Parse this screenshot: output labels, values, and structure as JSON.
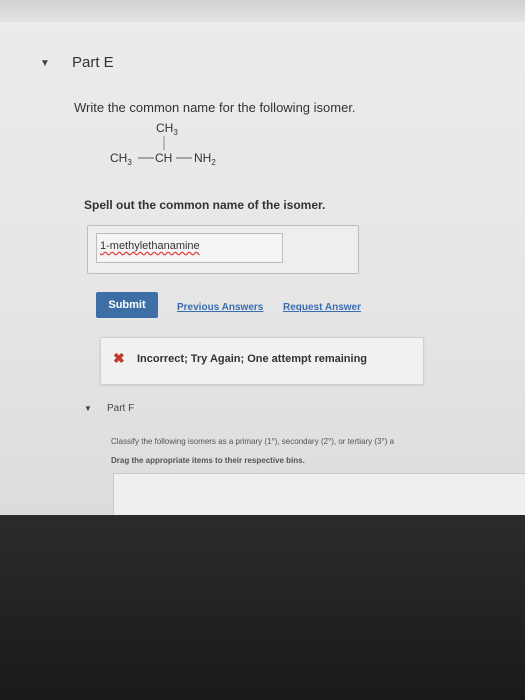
{
  "part_e": {
    "title": "Part E",
    "question": "Write the common name for the following isomer.",
    "molecule": {
      "top": "CH3",
      "left": "CH3",
      "center": "CH",
      "right": "NH2"
    },
    "instruction": "Spell out the common name of the isomer.",
    "answer_value": "1-methylethanamine",
    "submit_label": "Submit",
    "previous_answers_label": "Previous Answers",
    "request_answer_label": "Request Answer",
    "feedback": "Incorrect; Try Again; One attempt remaining"
  },
  "part_f": {
    "title": "Part F",
    "classify_text": "Classify the following isomers as a primary (1°), secondary (2°), or tertiary (3°) a",
    "drag_text": "Drag the appropriate items to their respective bins."
  },
  "icons": {
    "collapse": "chevron-down-icon",
    "error": "x-mark-icon"
  },
  "colors": {
    "submit_bg": "#3d6fa6",
    "link": "#3a6db0",
    "error": "#c0392b"
  }
}
